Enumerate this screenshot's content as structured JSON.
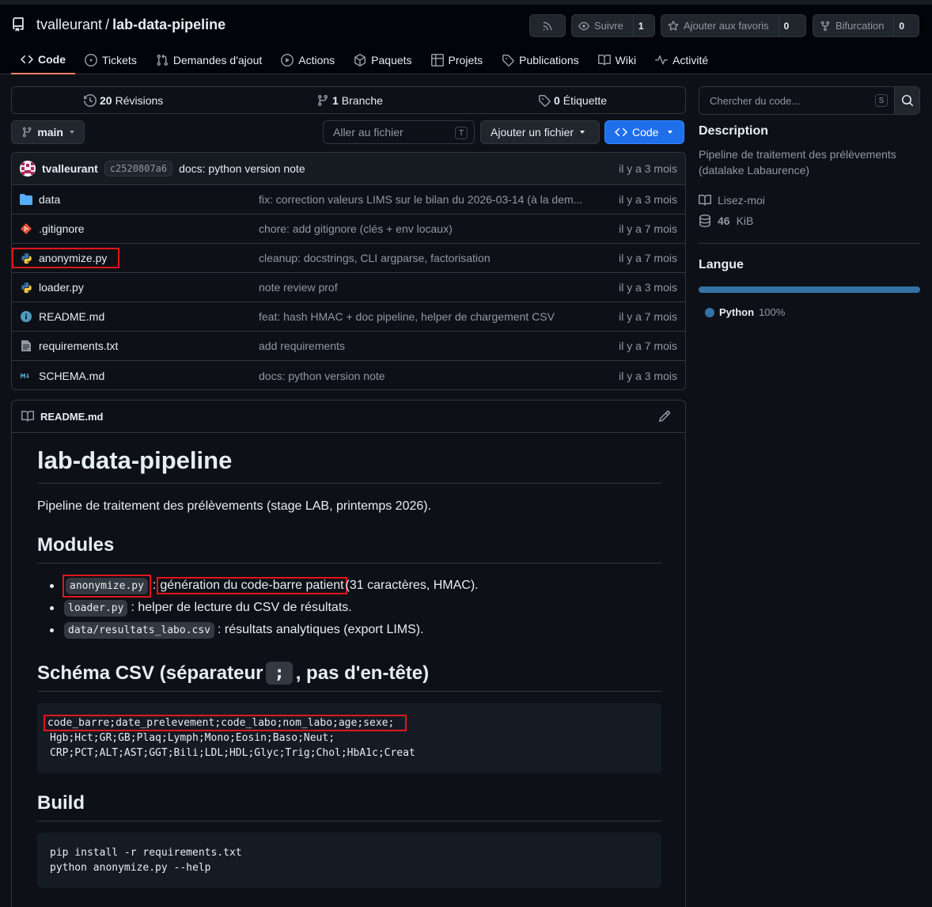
{
  "repo": {
    "owner": "tvalleurant",
    "separator": "/",
    "name": "lab-data-pipeline"
  },
  "header_buttons": {
    "watch_label": "Suivre",
    "watch_count": "1",
    "star_label": "Ajouter aux favoris",
    "star_count": "0",
    "fork_label": "Bifurcation",
    "fork_count": "0"
  },
  "tabs": [
    {
      "label": "Code",
      "icon": "code-icon"
    },
    {
      "label": "Tickets",
      "icon": "issue-icon"
    },
    {
      "label": "Demandes d'ajout",
      "icon": "pull-request-icon"
    },
    {
      "label": "Actions",
      "icon": "play-icon"
    },
    {
      "label": "Paquets",
      "icon": "package-icon"
    },
    {
      "label": "Projets",
      "icon": "table-icon"
    },
    {
      "label": "Publications",
      "icon": "tag-icon"
    },
    {
      "label": "Wiki",
      "icon": "book-icon"
    },
    {
      "label": "Activité",
      "icon": "pulse-icon"
    }
  ],
  "stats": {
    "revisions_count": "20",
    "revisions_label": "Révisions",
    "branches_count": "1",
    "branches_label": "Branche",
    "tags_count": "0",
    "tags_label": "Étiquette"
  },
  "branch": {
    "name": "main"
  },
  "goto_file": {
    "placeholder": "Aller au fichier",
    "shortcut": "T"
  },
  "add_file_label": "Ajouter un fichier",
  "code_button_label": "Code",
  "latest_commit": {
    "user": "tvalleurant",
    "sha": "c2520807a6",
    "message": "docs: python version note",
    "time": "il y a 3 mois"
  },
  "files": [
    {
      "name": "data",
      "icon": "folder-icon",
      "message": "fix: correction valeurs LIMS sur le bilan du 2026-03-14 (à la dem...",
      "time": "il y a 3 mois"
    },
    {
      "name": ".gitignore",
      "icon": "git-icon",
      "message": "chore: add gitignore (clés + env locaux)",
      "time": "il y a 7 mois"
    },
    {
      "name": "anonymize.py",
      "icon": "python-icon",
      "message": "cleanup: docstrings, CLI argparse, factorisation",
      "time": "il y a 7 mois"
    },
    {
      "name": "loader.py",
      "icon": "python-icon",
      "message": "note review prof",
      "time": "il y a 3 mois"
    },
    {
      "name": "README.md",
      "icon": "info-icon",
      "message": "feat: hash HMAC + doc pipeline, helper de chargement CSV",
      "time": "il y a 7 mois"
    },
    {
      "name": "requirements.txt",
      "icon": "text-file-icon",
      "message": "add requirements",
      "time": "il y a 7 mois"
    },
    {
      "name": "SCHEMA.md",
      "icon": "markdown-icon",
      "message": "docs: python version note",
      "time": "il y a 3 mois"
    }
  ],
  "readme": {
    "file_label": "README.md",
    "title": "lab-data-pipeline",
    "intro": "Pipeline de traitement des prélèvements (stage LAB, printemps 2026).",
    "modules_heading": "Modules",
    "modules": [
      {
        "code": "anonymize.py",
        "sep": ":",
        "text_hl": "génération du code-barre patient",
        "text": "(31 caractères, HMAC)."
      },
      {
        "code": "loader.py",
        "text": ": helper de lecture du CSV de résultats."
      },
      {
        "code": "data/resultats_labo.csv",
        "text": ": résultats analytiques (export LIMS)."
      }
    ],
    "schema_heading_before": "Schéma CSV (séparateur",
    "schema_heading_code": ";",
    "schema_heading_after": ", pas d'en-tête)",
    "schema_lines": [
      "code_barre;date_prelevement;code_labo;nom_labo;age;sexe;",
      "Hgb;Hct;GR;GB;Plaq;Lymph;Mono;Eosin;Baso;Neut;",
      "CRP;PCT;ALT;AST;GGT;Bili;LDL;HDL;Glyc;Trig;Chol;HbA1c;Creat"
    ],
    "build_heading": "Build",
    "build_lines": [
      "pip install -r requirements.txt",
      "python anonymize.py --help"
    ]
  },
  "sidebar": {
    "search_placeholder": "Chercher du code...",
    "search_shortcut": "S",
    "description_heading": "Description",
    "description": "Pipeline de traitement des prélèvements (datalake Labaurence)",
    "readme_link": "Lisez-moi",
    "size_value": "46",
    "size_unit": "KiB",
    "language_heading": "Langue",
    "language_name": "Python",
    "language_percent": "100%",
    "language_share": 1.0,
    "language_color": "#3572a5"
  },
  "colors": {
    "accent": "#1f6feb",
    "tab_underline": "#f78166",
    "highlight_box": "#e0161c"
  }
}
